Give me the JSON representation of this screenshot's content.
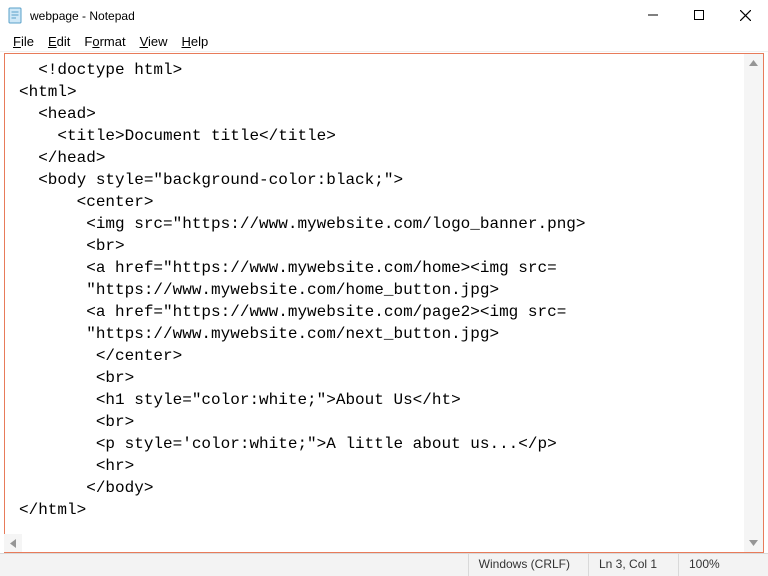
{
  "title": "webpage - Notepad",
  "menu": {
    "file": "File",
    "edit": "Edit",
    "format": "Format",
    "view": "View",
    "help": "Help"
  },
  "editor": {
    "content": "  <!doctype html>\n<html>\n  <head>\n    <title>Document title</title>\n  </head>\n  <body style=\"background-color:black;\">\n      <center>\n       <img src=\"https://www.mywebsite.com/logo_banner.png>\n       <br>\n       <a href=\"https://www.mywebsite.com/home><img src=\n       \"https://www.mywebsite.com/home_button.jpg>\n       <a href=\"https://www.mywebsite.com/page2><img src=\n       \"https://www.mywebsite.com/next_button.jpg>\n        </center>\n        <br>\n        <h1 style=\"color:white;\">About Us</ht>\n        <br>\n        <p style='color:white;\">A little about us...</p>\n        <hr>\n       </body>\n</html>"
  },
  "status": {
    "encoding": "Windows (CRLF)",
    "position": "Ln 3, Col 1",
    "zoom": "100%"
  }
}
